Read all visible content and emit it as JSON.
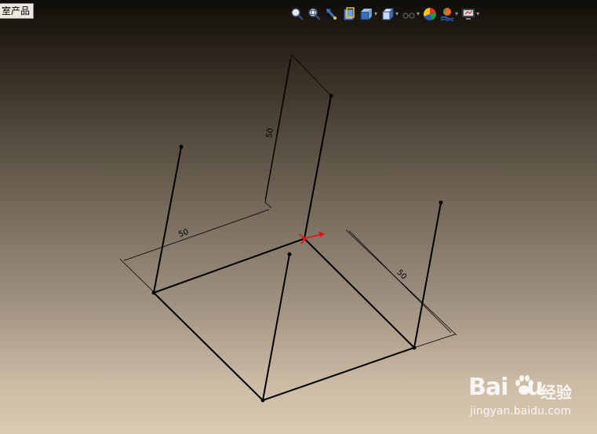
{
  "document_tab": {
    "label": "室产品"
  },
  "toolbar": {
    "buttons": [
      {
        "icon": "zoom-to-fit-icon"
      },
      {
        "icon": "zoom-to-area-icon"
      },
      {
        "icon": "previous-view-icon"
      },
      {
        "icon": "section-view-icon"
      },
      {
        "icon": "view-orientation-icon",
        "dropdown": true
      },
      {
        "icon": "display-style-icon",
        "dropdown": true
      },
      {
        "icon": "hide-show-items-icon",
        "dropdown": true
      },
      {
        "icon": "edit-appearance-icon"
      },
      {
        "icon": "apply-scene-icon",
        "dropdown": true
      },
      {
        "icon": "view-settings-icon",
        "dropdown": true
      }
    ],
    "dropdown_glyph": "▾"
  },
  "sketch": {
    "dimensions": [
      {
        "label": "50"
      },
      {
        "label": "50"
      },
      {
        "label": "50"
      }
    ],
    "origin_color": "#e01010",
    "line_color": "#000000"
  },
  "watermark": {
    "logo_text": "Bai",
    "logo_text_end": "u",
    "cn_text": "经验",
    "url": "jingyan.baidu.com"
  }
}
